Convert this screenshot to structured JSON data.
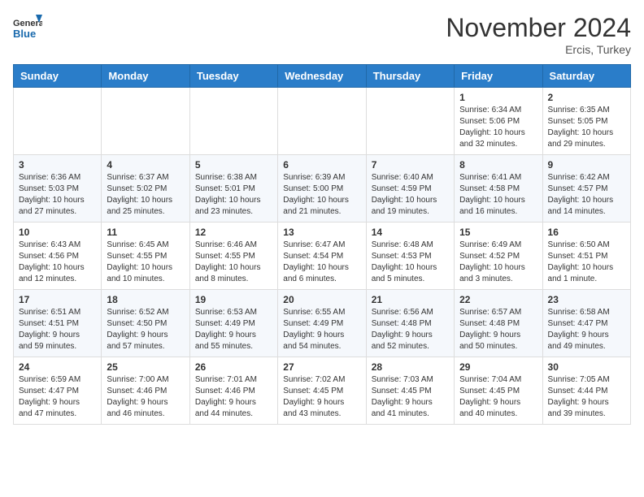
{
  "logo": {
    "text_general": "General",
    "text_blue": "Blue"
  },
  "header": {
    "month": "November 2024",
    "location": "Ercis, Turkey"
  },
  "weekdays": [
    "Sunday",
    "Monday",
    "Tuesday",
    "Wednesday",
    "Thursday",
    "Friday",
    "Saturday"
  ],
  "weeks": [
    [
      {
        "day": "",
        "info": ""
      },
      {
        "day": "",
        "info": ""
      },
      {
        "day": "",
        "info": ""
      },
      {
        "day": "",
        "info": ""
      },
      {
        "day": "",
        "info": ""
      },
      {
        "day": "1",
        "info": "Sunrise: 6:34 AM\nSunset: 5:06 PM\nDaylight: 10 hours\nand 32 minutes."
      },
      {
        "day": "2",
        "info": "Sunrise: 6:35 AM\nSunset: 5:05 PM\nDaylight: 10 hours\nand 29 minutes."
      }
    ],
    [
      {
        "day": "3",
        "info": "Sunrise: 6:36 AM\nSunset: 5:03 PM\nDaylight: 10 hours\nand 27 minutes."
      },
      {
        "day": "4",
        "info": "Sunrise: 6:37 AM\nSunset: 5:02 PM\nDaylight: 10 hours\nand 25 minutes."
      },
      {
        "day": "5",
        "info": "Sunrise: 6:38 AM\nSunset: 5:01 PM\nDaylight: 10 hours\nand 23 minutes."
      },
      {
        "day": "6",
        "info": "Sunrise: 6:39 AM\nSunset: 5:00 PM\nDaylight: 10 hours\nand 21 minutes."
      },
      {
        "day": "7",
        "info": "Sunrise: 6:40 AM\nSunset: 4:59 PM\nDaylight: 10 hours\nand 19 minutes."
      },
      {
        "day": "8",
        "info": "Sunrise: 6:41 AM\nSunset: 4:58 PM\nDaylight: 10 hours\nand 16 minutes."
      },
      {
        "day": "9",
        "info": "Sunrise: 6:42 AM\nSunset: 4:57 PM\nDaylight: 10 hours\nand 14 minutes."
      }
    ],
    [
      {
        "day": "10",
        "info": "Sunrise: 6:43 AM\nSunset: 4:56 PM\nDaylight: 10 hours\nand 12 minutes."
      },
      {
        "day": "11",
        "info": "Sunrise: 6:45 AM\nSunset: 4:55 PM\nDaylight: 10 hours\nand 10 minutes."
      },
      {
        "day": "12",
        "info": "Sunrise: 6:46 AM\nSunset: 4:55 PM\nDaylight: 10 hours\nand 8 minutes."
      },
      {
        "day": "13",
        "info": "Sunrise: 6:47 AM\nSunset: 4:54 PM\nDaylight: 10 hours\nand 6 minutes."
      },
      {
        "day": "14",
        "info": "Sunrise: 6:48 AM\nSunset: 4:53 PM\nDaylight: 10 hours\nand 5 minutes."
      },
      {
        "day": "15",
        "info": "Sunrise: 6:49 AM\nSunset: 4:52 PM\nDaylight: 10 hours\nand 3 minutes."
      },
      {
        "day": "16",
        "info": "Sunrise: 6:50 AM\nSunset: 4:51 PM\nDaylight: 10 hours\nand 1 minute."
      }
    ],
    [
      {
        "day": "17",
        "info": "Sunrise: 6:51 AM\nSunset: 4:51 PM\nDaylight: 9 hours\nand 59 minutes."
      },
      {
        "day": "18",
        "info": "Sunrise: 6:52 AM\nSunset: 4:50 PM\nDaylight: 9 hours\nand 57 minutes."
      },
      {
        "day": "19",
        "info": "Sunrise: 6:53 AM\nSunset: 4:49 PM\nDaylight: 9 hours\nand 55 minutes."
      },
      {
        "day": "20",
        "info": "Sunrise: 6:55 AM\nSunset: 4:49 PM\nDaylight: 9 hours\nand 54 minutes."
      },
      {
        "day": "21",
        "info": "Sunrise: 6:56 AM\nSunset: 4:48 PM\nDaylight: 9 hours\nand 52 minutes."
      },
      {
        "day": "22",
        "info": "Sunrise: 6:57 AM\nSunset: 4:48 PM\nDaylight: 9 hours\nand 50 minutes."
      },
      {
        "day": "23",
        "info": "Sunrise: 6:58 AM\nSunset: 4:47 PM\nDaylight: 9 hours\nand 49 minutes."
      }
    ],
    [
      {
        "day": "24",
        "info": "Sunrise: 6:59 AM\nSunset: 4:47 PM\nDaylight: 9 hours\nand 47 minutes."
      },
      {
        "day": "25",
        "info": "Sunrise: 7:00 AM\nSunset: 4:46 PM\nDaylight: 9 hours\nand 46 minutes."
      },
      {
        "day": "26",
        "info": "Sunrise: 7:01 AM\nSunset: 4:46 PM\nDaylight: 9 hours\nand 44 minutes."
      },
      {
        "day": "27",
        "info": "Sunrise: 7:02 AM\nSunset: 4:45 PM\nDaylight: 9 hours\nand 43 minutes."
      },
      {
        "day": "28",
        "info": "Sunrise: 7:03 AM\nSunset: 4:45 PM\nDaylight: 9 hours\nand 41 minutes."
      },
      {
        "day": "29",
        "info": "Sunrise: 7:04 AM\nSunset: 4:45 PM\nDaylight: 9 hours\nand 40 minutes."
      },
      {
        "day": "30",
        "info": "Sunrise: 7:05 AM\nSunset: 4:44 PM\nDaylight: 9 hours\nand 39 minutes."
      }
    ]
  ]
}
